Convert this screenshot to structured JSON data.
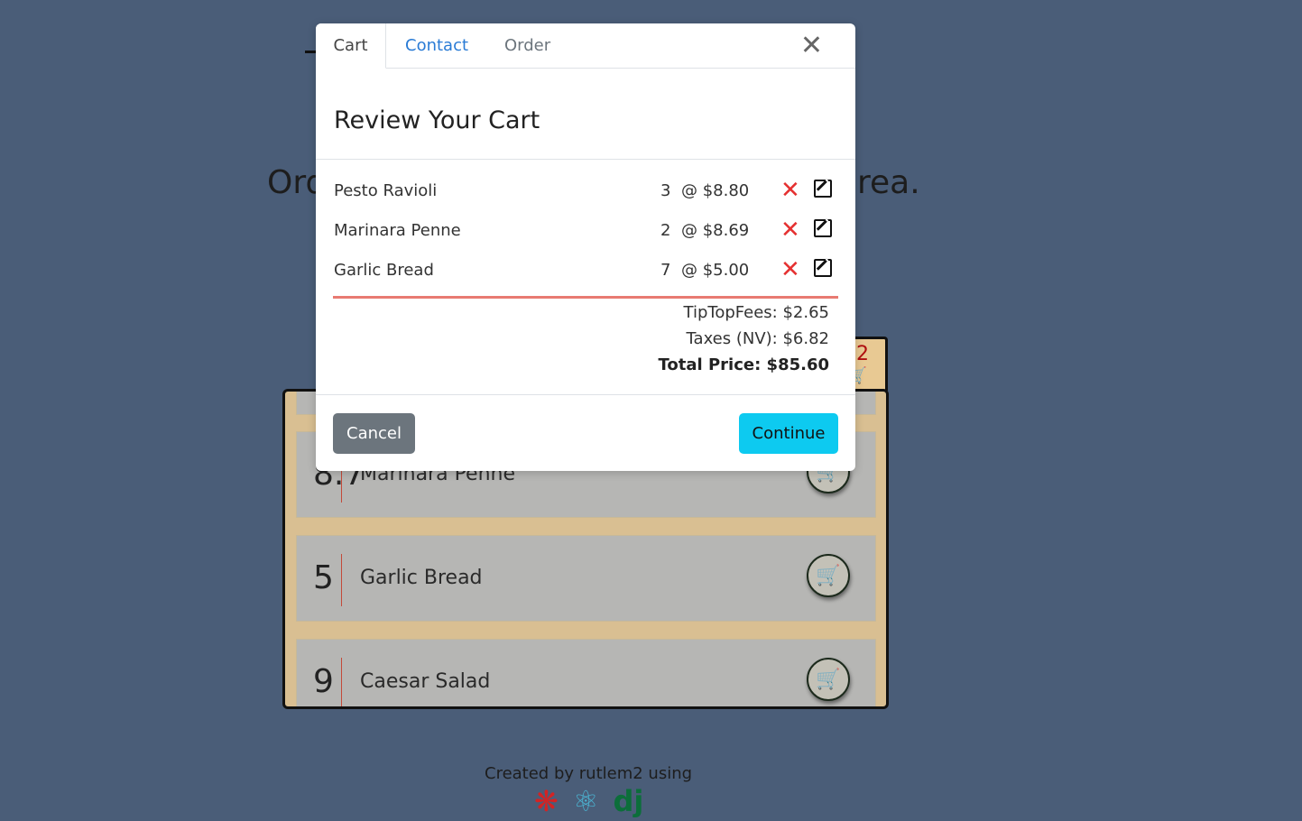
{
  "background": {
    "tagline_left": "Ord",
    "tagline_right": "rea.",
    "cart_count": "2",
    "menu_items": [
      {
        "price": "8.7",
        "name": "Marinara Penne"
      },
      {
        "price": "5",
        "name": "Garlic Bread"
      },
      {
        "price": "9",
        "name": "Caesar Salad"
      }
    ],
    "footer": {
      "credit": "Created by rutlem2 using",
      "icons": [
        "yelp-icon",
        "react-icon",
        "django-icon"
      ]
    }
  },
  "modal": {
    "tabs": [
      {
        "label": "Cart",
        "active": true
      },
      {
        "label": "Contact",
        "active": false
      },
      {
        "label": "Order",
        "active": false
      }
    ],
    "close_icon": "close-icon",
    "title": "Review Your Cart",
    "items": [
      {
        "name": "Pesto Ravioli",
        "qty": "3",
        "unit": "@ $8.80"
      },
      {
        "name": "Marinara Penne",
        "qty": "2",
        "unit": "@ $8.69"
      },
      {
        "name": "Garlic Bread",
        "qty": "7",
        "unit": "@ $5.00"
      }
    ],
    "fees": "TipTopFees: $2.65",
    "taxes": "Taxes (NV): $6.82",
    "total": "Total Price: $85.60",
    "cancel_label": "Cancel",
    "continue_label": "Continue"
  },
  "colors": {
    "page_bg": "#4a5d78",
    "delete": "#e53030",
    "total_rule": "#e87a72",
    "continue_bg": "#0dcaf0",
    "cancel_bg": "#6c757d",
    "contact_tab": "#2a7bd5"
  }
}
